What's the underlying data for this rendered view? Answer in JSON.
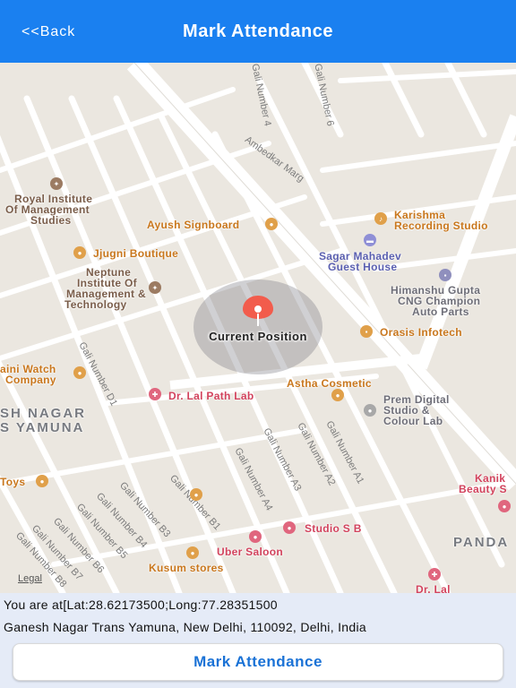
{
  "navbar": {
    "back_label": "<<Back",
    "title": "Mark Attendance",
    "color": "#1a80f0"
  },
  "map": {
    "current_position_label": "Current Position",
    "legal_label": "Legal",
    "pois": {
      "royal1": "Royal Institute",
      "royal2": "Of Management",
      "royal3": "Studies",
      "ayush": "Ayush Signboard",
      "karishma1": "Karishma",
      "karishma2": "Recording Studio",
      "sagar1": "Sagar Mahadev",
      "sagar2": "Guest House",
      "jjugni": "Jjugni Boutique",
      "neptune1": "Neptune",
      "neptune2": "Institute Of",
      "neptune3": "Management &",
      "neptune4": "Technology",
      "himanshu1": "Himanshu Gupta",
      "himanshu2": "CNG Champion",
      "himanshu3": "Auto Parts",
      "orasis": "Orasis Infotech",
      "watch1": "aini Watch",
      "watch2": "Company",
      "drlal": "Dr. Lal Path Lab",
      "astha": "Astha Cosmetic",
      "prem1": "Prem Digital",
      "prem2": "Studio &",
      "prem3": "Colour Lab",
      "area1": "SH NAGAR",
      "area2": "S YAMUNA",
      "toys": "Toys",
      "kanika1": "Kanik",
      "kanika2": "Beauty S",
      "studio": "Studio S B",
      "uber": "Uber Saloon",
      "kusum": "Kusum stores",
      "panda": "PANDA",
      "drlal2": "Dr. Lal"
    },
    "streets": {
      "ambedkar": "Ambedkar Marg",
      "gali4": "Gali Number 4",
      "gali6": "Gali Number 6",
      "galid1": "Gali Number D1",
      "galia1": "Gali Number A1",
      "galia2": "Gali Number A2",
      "galia3": "Gali Number A3",
      "galia4": "Gali Number A4",
      "galib1": "Gali Number B1",
      "galib3": "Gali Number B3",
      "galib4": "Gali Number B4",
      "galib5": "Gali Number B5",
      "galib6": "Gali Number B6",
      "galib7": "Gali Number B7",
      "galib8": "Gali Number B8"
    }
  },
  "info": {
    "coordinates": "You are at[Lat:28.62173500;Long:77.28351500",
    "address": "Ganesh Nagar Trans Yamuna, New Delhi, 110092, Delhi, India"
  },
  "action": {
    "mark_label": "Mark Attendance"
  }
}
